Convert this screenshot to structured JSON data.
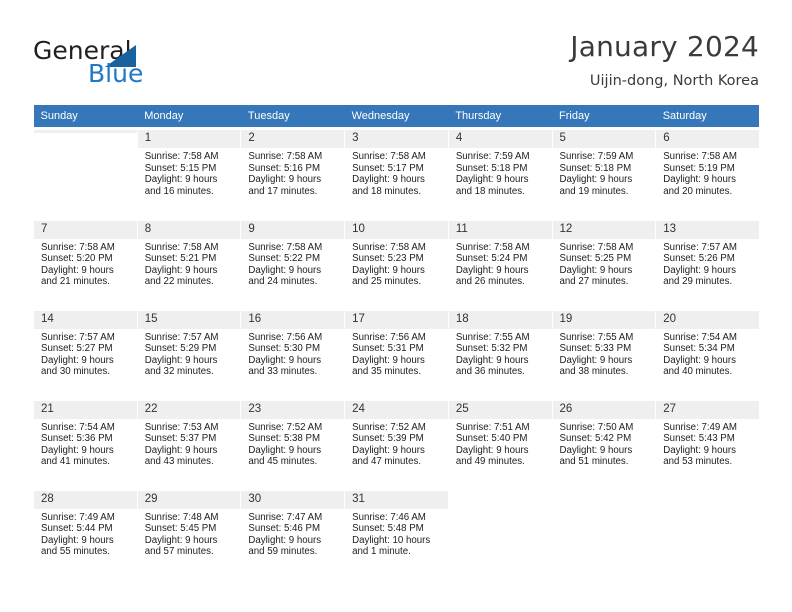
{
  "brand": {
    "name_part1": "General",
    "name_part2": "Blue",
    "accent_color": "#2079c7",
    "triangle_color": "#18639f"
  },
  "header": {
    "title": "January 2024",
    "subtitle": "Uijin-dong, North Korea"
  },
  "calendar": {
    "header_bg": "#3577b8",
    "header_text_color": "#ffffff",
    "weekdays": [
      "Sunday",
      "Monday",
      "Tuesday",
      "Wednesday",
      "Thursday",
      "Friday",
      "Saturday"
    ],
    "weeks": [
      [
        {
          "day": "",
          "sunrise": "",
          "sunset": "",
          "daylight1": "",
          "daylight2": ""
        },
        {
          "day": "1",
          "sunrise": "Sunrise: 7:58 AM",
          "sunset": "Sunset: 5:15 PM",
          "daylight1": "Daylight: 9 hours",
          "daylight2": "and 16 minutes."
        },
        {
          "day": "2",
          "sunrise": "Sunrise: 7:58 AM",
          "sunset": "Sunset: 5:16 PM",
          "daylight1": "Daylight: 9 hours",
          "daylight2": "and 17 minutes."
        },
        {
          "day": "3",
          "sunrise": "Sunrise: 7:58 AM",
          "sunset": "Sunset: 5:17 PM",
          "daylight1": "Daylight: 9 hours",
          "daylight2": "and 18 minutes."
        },
        {
          "day": "4",
          "sunrise": "Sunrise: 7:59 AM",
          "sunset": "Sunset: 5:18 PM",
          "daylight1": "Daylight: 9 hours",
          "daylight2": "and 18 minutes."
        },
        {
          "day": "5",
          "sunrise": "Sunrise: 7:59 AM",
          "sunset": "Sunset: 5:18 PM",
          "daylight1": "Daylight: 9 hours",
          "daylight2": "and 19 minutes."
        },
        {
          "day": "6",
          "sunrise": "Sunrise: 7:58 AM",
          "sunset": "Sunset: 5:19 PM",
          "daylight1": "Daylight: 9 hours",
          "daylight2": "and 20 minutes."
        }
      ],
      [
        {
          "day": "7",
          "sunrise": "Sunrise: 7:58 AM",
          "sunset": "Sunset: 5:20 PM",
          "daylight1": "Daylight: 9 hours",
          "daylight2": "and 21 minutes."
        },
        {
          "day": "8",
          "sunrise": "Sunrise: 7:58 AM",
          "sunset": "Sunset: 5:21 PM",
          "daylight1": "Daylight: 9 hours",
          "daylight2": "and 22 minutes."
        },
        {
          "day": "9",
          "sunrise": "Sunrise: 7:58 AM",
          "sunset": "Sunset: 5:22 PM",
          "daylight1": "Daylight: 9 hours",
          "daylight2": "and 24 minutes."
        },
        {
          "day": "10",
          "sunrise": "Sunrise: 7:58 AM",
          "sunset": "Sunset: 5:23 PM",
          "daylight1": "Daylight: 9 hours",
          "daylight2": "and 25 minutes."
        },
        {
          "day": "11",
          "sunrise": "Sunrise: 7:58 AM",
          "sunset": "Sunset: 5:24 PM",
          "daylight1": "Daylight: 9 hours",
          "daylight2": "and 26 minutes."
        },
        {
          "day": "12",
          "sunrise": "Sunrise: 7:58 AM",
          "sunset": "Sunset: 5:25 PM",
          "daylight1": "Daylight: 9 hours",
          "daylight2": "and 27 minutes."
        },
        {
          "day": "13",
          "sunrise": "Sunrise: 7:57 AM",
          "sunset": "Sunset: 5:26 PM",
          "daylight1": "Daylight: 9 hours",
          "daylight2": "and 29 minutes."
        }
      ],
      [
        {
          "day": "14",
          "sunrise": "Sunrise: 7:57 AM",
          "sunset": "Sunset: 5:27 PM",
          "daylight1": "Daylight: 9 hours",
          "daylight2": "and 30 minutes."
        },
        {
          "day": "15",
          "sunrise": "Sunrise: 7:57 AM",
          "sunset": "Sunset: 5:29 PM",
          "daylight1": "Daylight: 9 hours",
          "daylight2": "and 32 minutes."
        },
        {
          "day": "16",
          "sunrise": "Sunrise: 7:56 AM",
          "sunset": "Sunset: 5:30 PM",
          "daylight1": "Daylight: 9 hours",
          "daylight2": "and 33 minutes."
        },
        {
          "day": "17",
          "sunrise": "Sunrise: 7:56 AM",
          "sunset": "Sunset: 5:31 PM",
          "daylight1": "Daylight: 9 hours",
          "daylight2": "and 35 minutes."
        },
        {
          "day": "18",
          "sunrise": "Sunrise: 7:55 AM",
          "sunset": "Sunset: 5:32 PM",
          "daylight1": "Daylight: 9 hours",
          "daylight2": "and 36 minutes."
        },
        {
          "day": "19",
          "sunrise": "Sunrise: 7:55 AM",
          "sunset": "Sunset: 5:33 PM",
          "daylight1": "Daylight: 9 hours",
          "daylight2": "and 38 minutes."
        },
        {
          "day": "20",
          "sunrise": "Sunrise: 7:54 AM",
          "sunset": "Sunset: 5:34 PM",
          "daylight1": "Daylight: 9 hours",
          "daylight2": "and 40 minutes."
        }
      ],
      [
        {
          "day": "21",
          "sunrise": "Sunrise: 7:54 AM",
          "sunset": "Sunset: 5:36 PM",
          "daylight1": "Daylight: 9 hours",
          "daylight2": "and 41 minutes."
        },
        {
          "day": "22",
          "sunrise": "Sunrise: 7:53 AM",
          "sunset": "Sunset: 5:37 PM",
          "daylight1": "Daylight: 9 hours",
          "daylight2": "and 43 minutes."
        },
        {
          "day": "23",
          "sunrise": "Sunrise: 7:52 AM",
          "sunset": "Sunset: 5:38 PM",
          "daylight1": "Daylight: 9 hours",
          "daylight2": "and 45 minutes."
        },
        {
          "day": "24",
          "sunrise": "Sunrise: 7:52 AM",
          "sunset": "Sunset: 5:39 PM",
          "daylight1": "Daylight: 9 hours",
          "daylight2": "and 47 minutes."
        },
        {
          "day": "25",
          "sunrise": "Sunrise: 7:51 AM",
          "sunset": "Sunset: 5:40 PM",
          "daylight1": "Daylight: 9 hours",
          "daylight2": "and 49 minutes."
        },
        {
          "day": "26",
          "sunrise": "Sunrise: 7:50 AM",
          "sunset": "Sunset: 5:42 PM",
          "daylight1": "Daylight: 9 hours",
          "daylight2": "and 51 minutes."
        },
        {
          "day": "27",
          "sunrise": "Sunrise: 7:49 AM",
          "sunset": "Sunset: 5:43 PM",
          "daylight1": "Daylight: 9 hours",
          "daylight2": "and 53 minutes."
        }
      ],
      [
        {
          "day": "28",
          "sunrise": "Sunrise: 7:49 AM",
          "sunset": "Sunset: 5:44 PM",
          "daylight1": "Daylight: 9 hours",
          "daylight2": "and 55 minutes."
        },
        {
          "day": "29",
          "sunrise": "Sunrise: 7:48 AM",
          "sunset": "Sunset: 5:45 PM",
          "daylight1": "Daylight: 9 hours",
          "daylight2": "and 57 minutes."
        },
        {
          "day": "30",
          "sunrise": "Sunrise: 7:47 AM",
          "sunset": "Sunset: 5:46 PM",
          "daylight1": "Daylight: 9 hours",
          "daylight2": "and 59 minutes."
        },
        {
          "day": "31",
          "sunrise": "Sunrise: 7:46 AM",
          "sunset": "Sunset: 5:48 PM",
          "daylight1": "Daylight: 10 hours",
          "daylight2": "and 1 minute."
        },
        {
          "day": "",
          "sunrise": "",
          "sunset": "",
          "daylight1": "",
          "daylight2": ""
        },
        {
          "day": "",
          "sunrise": "",
          "sunset": "",
          "daylight1": "",
          "daylight2": ""
        },
        {
          "day": "",
          "sunrise": "",
          "sunset": "",
          "daylight1": "",
          "daylight2": ""
        }
      ]
    ]
  }
}
